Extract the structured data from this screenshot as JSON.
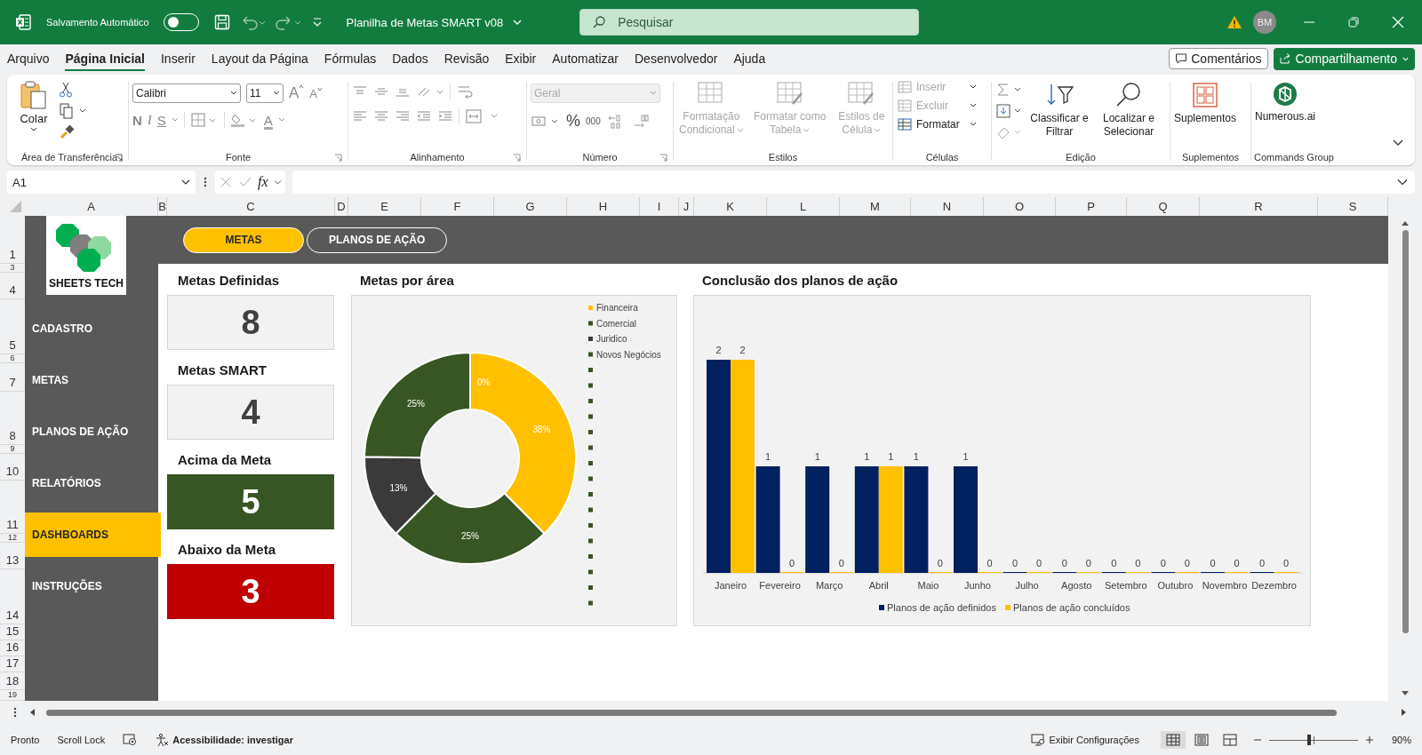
{
  "title_bar": {
    "autosave_label": "Salvamento Automático",
    "autosave_on": false,
    "document_title": "Planilha de Metas SMART v08",
    "search": {
      "placeholder": "Pesquisar"
    },
    "avatar": "BM"
  },
  "menu_tabs": [
    {
      "label": "Arquivo",
      "selected": false
    },
    {
      "label": "Página Inicial",
      "selected": true
    },
    {
      "label": "Inserir",
      "selected": false
    },
    {
      "label": "Layout da Página",
      "selected": false
    },
    {
      "label": "Fórmulas",
      "selected": false
    },
    {
      "label": "Dados",
      "selected": false
    },
    {
      "label": "Revisão",
      "selected": false
    },
    {
      "label": "Exibir",
      "selected": false
    },
    {
      "label": "Automatizar",
      "selected": false
    },
    {
      "label": "Desenvolvedor",
      "selected": false
    },
    {
      "label": "Ajuda",
      "selected": false
    }
  ],
  "comments_button": "Comentários",
  "share_button": "Compartilhamento",
  "ribbon": {
    "clipboard": {
      "paste": "Colar",
      "group": "Área de Transferência"
    },
    "font": {
      "name": "Calibri",
      "size": "11",
      "grow": "A",
      "shrink": "A",
      "styles": [
        "N",
        "I",
        "S"
      ],
      "color_glyph": "A",
      "group": "Fonte"
    },
    "alignment": {
      "group": "Alinhamento"
    },
    "number": {
      "format": "Geral",
      "format_disabled": true,
      "percent": "%",
      "thousands": "000",
      "group": "Número"
    },
    "styles": {
      "items": [
        {
          "label": "Formatação Condicional",
          "disabled": true
        },
        {
          "label": "Formatar como Tabela",
          "disabled": true
        },
        {
          "label": "Estilos de Célula",
          "disabled": true
        }
      ],
      "group": "Estilos"
    },
    "cells": {
      "items": [
        {
          "label": "Inserir",
          "disabled": true
        },
        {
          "label": "Excluir",
          "disabled": true
        },
        {
          "label": "Formatar",
          "disabled": false
        }
      ],
      "group": "Células"
    },
    "editing": {
      "sort": "Classificar e Filtrar",
      "find": "Localizar e Selecionar",
      "group": "Edição"
    },
    "addins": {
      "label": "Suplementos",
      "group": "Suplementos"
    },
    "commands": {
      "label": "Numerous.ai",
      "group": "Commands Group"
    }
  },
  "formula_bar": {
    "name_box": "A1",
    "fx": "fx"
  },
  "columns": [
    "A",
    "B",
    "C",
    "D",
    "E",
    "F",
    "G",
    "H",
    "I",
    "J",
    "K",
    "L",
    "M",
    "N",
    "O",
    "P",
    "Q",
    "R",
    "S"
  ],
  "rows": [
    "1",
    "3",
    "4",
    "5",
    "6",
    "7",
    "8",
    "9",
    "10",
    "11",
    "12",
    "13",
    "14",
    "15",
    "16",
    "17",
    "18",
    "19"
  ],
  "dashboard": {
    "logo_text": "SHEETS TECH",
    "top_buttons": [
      {
        "label": "METAS",
        "selected": true
      },
      {
        "label": "PLANOS DE AÇÃO",
        "selected": false
      }
    ],
    "nav": [
      {
        "label": "CADASTRO",
        "selected": false
      },
      {
        "label": "METAS",
        "selected": false
      },
      {
        "label": "PLANOS DE AÇÃO",
        "selected": false
      },
      {
        "label": "RELATÓRIOS",
        "selected": false
      },
      {
        "label": "DASHBOARDS",
        "selected": true
      },
      {
        "label": "INSTRUÇÕES",
        "selected": false
      }
    ],
    "kpis": [
      {
        "title": "Metas Definidas",
        "value": "8",
        "color": "#f2f2f2"
      },
      {
        "title": "Metas SMART",
        "value": "4",
        "color": "#f2f2f2"
      },
      {
        "title": "Acima da Meta",
        "value": "5",
        "color": "#375623"
      },
      {
        "title": "Abaixo da Meta",
        "value": "3",
        "color": "#c00000"
      }
    ],
    "donut": {
      "title": "Metas por área",
      "chart_data": {
        "type": "donut",
        "categories": [
          "Financeira",
          "Comercial",
          "Juridico",
          "Novos Negócios"
        ],
        "values": [
          38,
          25,
          13,
          25
        ],
        "colors": [
          "#ffc000",
          "#375623",
          "#3a3a3a",
          "#375623"
        ],
        "data_labels": true,
        "value_labels": [
          "38%",
          "25%",
          "13%",
          "25%"
        ],
        "annotations": [
          {
            "text": "0%"
          }
        ],
        "legend": true
      }
    },
    "bars": {
      "title": "Conclusão dos planos de ação",
      "chart_data": {
        "type": "bar",
        "categories": [
          "Janeiro",
          "Fevereiro",
          "Março",
          "Abril",
          "Maio",
          "Junho",
          "Julho",
          "Agosto",
          "Setembro",
          "Outubro",
          "Novembro",
          "Dezembro"
        ],
        "series": [
          {
            "name": "Planos de ação definidos",
            "color": "#002060",
            "values": [
              2,
              1,
              1,
              1,
              1,
              1,
              0,
              0,
              0,
              0,
              0,
              0
            ]
          },
          {
            "name": "Planos de ação concluídos",
            "color": "#ffc000",
            "values": [
              2,
              0,
              0,
              1,
              0,
              0,
              0,
              0,
              0,
              0,
              0,
              0
            ]
          }
        ],
        "data_labels": true,
        "legend": true
      }
    }
  },
  "status_bar": {
    "ready": "Pronto",
    "scroll_lock": "Scroll Lock",
    "accessibility": "Acessibilidade: investigar",
    "display_settings": "Exibir Configurações",
    "views": [
      {
        "kind": "normal",
        "selected": true
      },
      {
        "kind": "page_layout",
        "selected": false
      },
      {
        "kind": "page_break",
        "selected": false
      }
    ],
    "zoom": {
      "level": 0.45,
      "label": "90%"
    }
  }
}
